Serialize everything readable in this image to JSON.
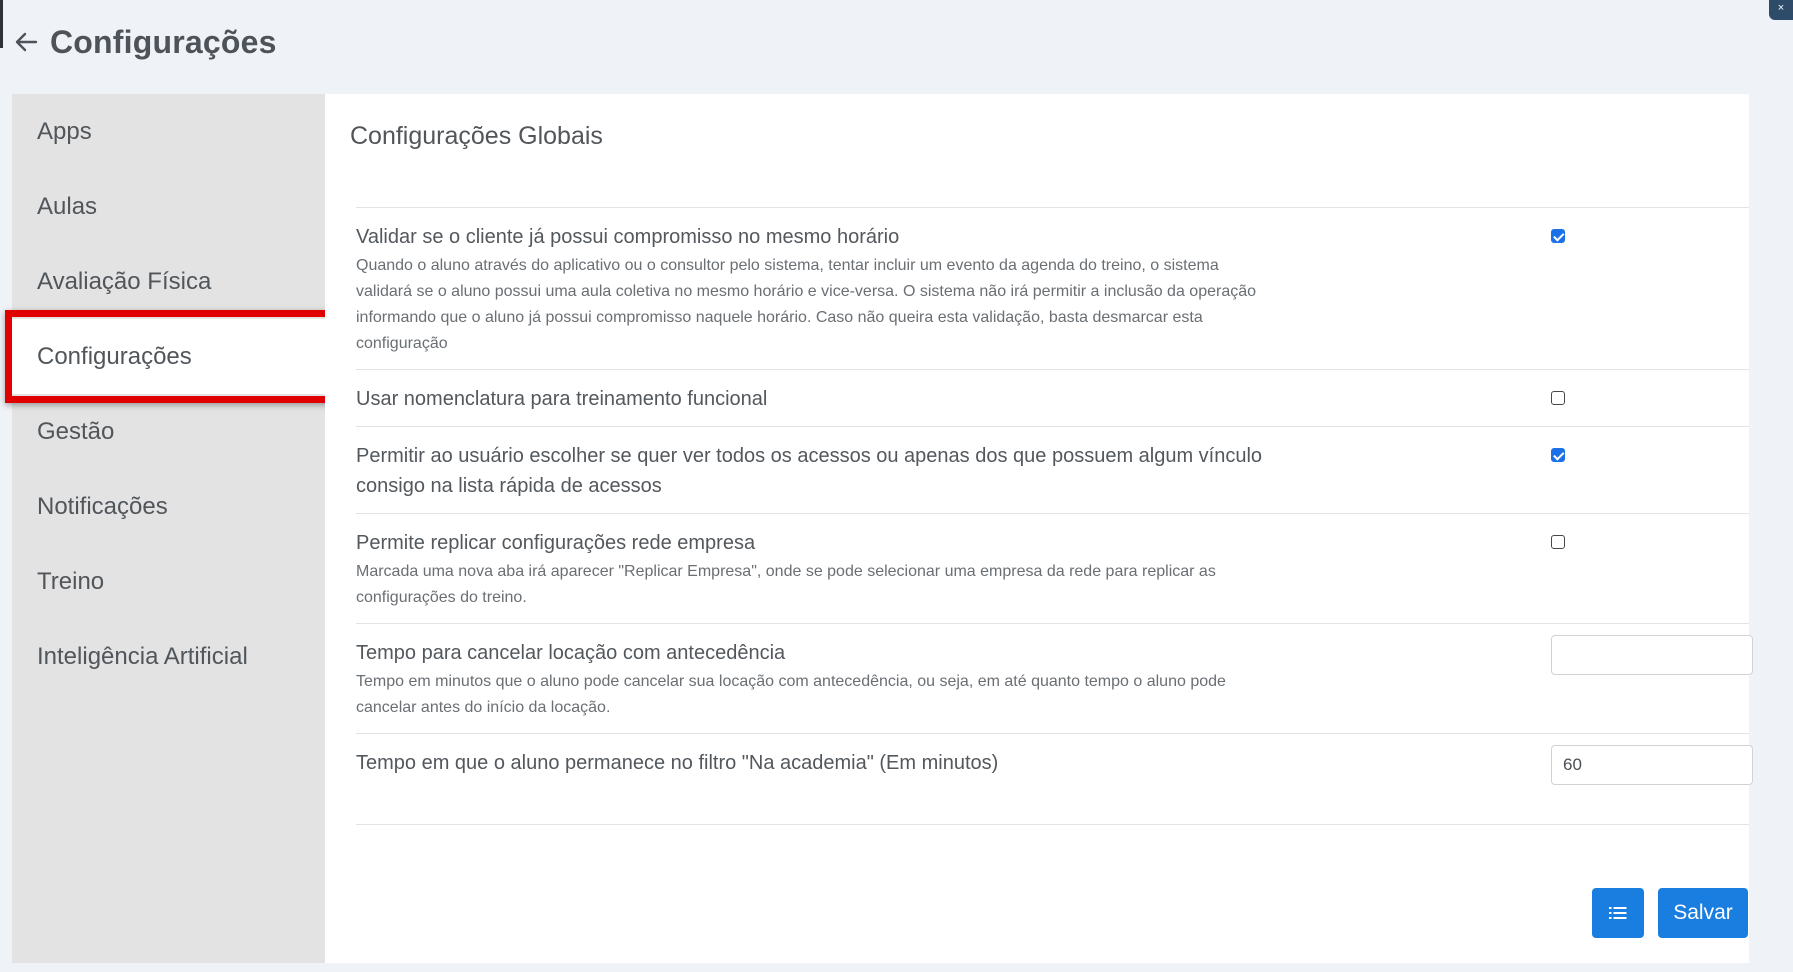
{
  "header": {
    "title": "Configurações"
  },
  "corner_icon": "×",
  "sidebar": {
    "items": [
      {
        "label": "Apps"
      },
      {
        "label": "Aulas"
      },
      {
        "label": "Avaliação Física"
      },
      {
        "label": "Configurações",
        "active": true
      },
      {
        "label": "Gestão"
      },
      {
        "label": "Notificações"
      },
      {
        "label": "Treino"
      },
      {
        "label": "Inteligência Artificial"
      }
    ]
  },
  "main": {
    "title": "Configurações Globais",
    "settings": [
      {
        "label": "Validar se o cliente já possui compromisso no mesmo horário",
        "description": "Quando o aluno através do aplicativo ou o consultor pelo sistema, tentar incluir um evento da agenda do treino, o sistema validará se o aluno possui uma aula coletiva no mesmo horário e vice-versa. O sistema não irá permitir a inclusão da operação informando que o aluno já possui compromisso naquele horário. Caso não queira esta validação, basta desmarcar esta configuração",
        "control": "checkbox",
        "checked": true
      },
      {
        "label": "Usar nomenclatura para treinamento funcional",
        "control": "checkbox",
        "checked": false
      },
      {
        "label": "Permitir ao usuário escolher se quer ver todos os acessos ou apenas dos que possuem algum vínculo consigo na lista rápida de acessos",
        "control": "checkbox",
        "checked": true
      },
      {
        "label": "Permite replicar configurações rede empresa",
        "description": "Marcada uma nova aba irá aparecer \"Replicar Empresa\", onde se pode selecionar uma empresa da rede para replicar as configurações do treino.",
        "control": "checkbox",
        "checked": false
      },
      {
        "label": "Tempo para cancelar locação com antecedência",
        "description": "Tempo em minutos que o aluno pode cancelar sua locação com antecedência, ou seja, em até quanto tempo o aluno pode cancelar antes do início da locação.",
        "control": "input",
        "value": ""
      },
      {
        "label": "Tempo em que o aluno permanece no filtro \"Na academia\" (Em minutos)",
        "control": "input",
        "value": "60"
      }
    ]
  },
  "buttons": {
    "save_label": "Salvar",
    "list_icon": "list-icon"
  },
  "colors": {
    "primary": "#1a7ee0",
    "highlight": "#e00000",
    "sidebar_bg": "#e3e3e3",
    "page_bg": "#eff2f7"
  }
}
